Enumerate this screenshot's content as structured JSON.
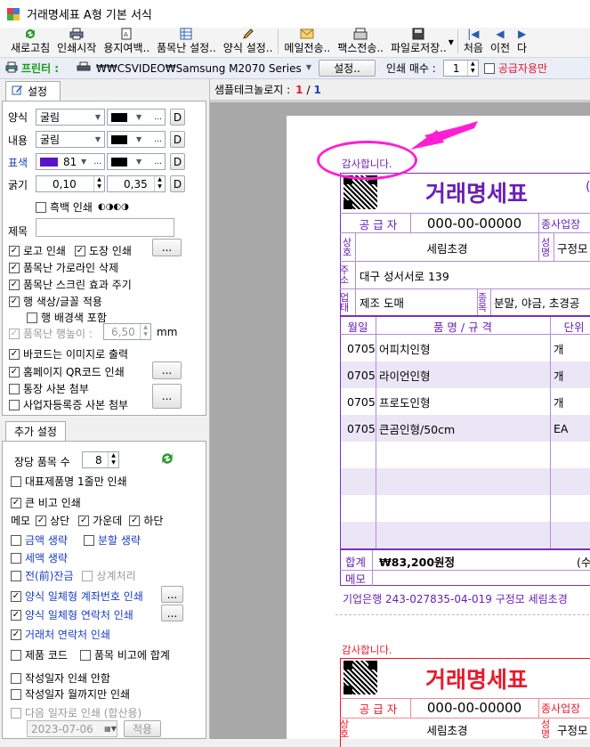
{
  "window": {
    "title": "거래명세표 A형 기본 서식"
  },
  "toolbar": {
    "items": [
      "새로고침",
      "인쇄시작",
      "용지여백..",
      "품목난 설정..",
      "양식 설정..",
      "메일전송..",
      "팩스전송..",
      "파일로저장..",
      "처음",
      "이전",
      "다"
    ]
  },
  "printer": {
    "label": "프린터 :",
    "name": "₩₩CSVIDEO₩Samsung M2070 Series",
    "settings_btn": "설정..",
    "copies_label": "인쇄 매수 :",
    "copies": "1",
    "supplier_only": "공급자용만"
  },
  "sample": {
    "label": "샘플테크놀로지 :",
    "page": "1",
    "sep": "/",
    "total": "1"
  },
  "settings": {
    "tab": "설정",
    "style_label": "양식",
    "style_font": "굴림",
    "content_label": "내용",
    "content_font": "굴림",
    "table_color_label": "표색",
    "table_color_value": "81",
    "weight_label": "굵기",
    "weight1": "0,10",
    "weight2": "0,35",
    "d": "D",
    "dots": "...",
    "bw_print": "흑백 인쇄",
    "bw_symbols": "◐◑◐◑",
    "title_label": "제목",
    "logo_print": "로고 인쇄",
    "stamp_print": "도장 인쇄",
    "remove_hlines": "품목난 가로라인 삭제",
    "screen_effect": "품목난 스크린 효과 주기",
    "row_color_font": "행 색상/글꼴 적용",
    "row_bg_include": "행 배경색 포함",
    "row_height_label": "품목난 행높이 :",
    "row_height": "6,50",
    "mm": "mm",
    "barcode_image": "바코드는 이미지로 출력",
    "homepage_qr": "홈페이지 QR코드 인쇄",
    "bankbook_copy": "통장 사본 첨부",
    "bizreg_copy": "사업자등록증 사본 첨부"
  },
  "extra": {
    "tab": "추가 설정",
    "items_per_page_label": "장당 품목 수",
    "items_per_page": "8",
    "rep_item_one_line": "대표제품명 1줄만 인쇄",
    "big_note": "큰 비고 인쇄",
    "memo_label": "메모",
    "memo_top": "상단",
    "memo_middle": "가운데",
    "memo_bottom": "하단",
    "amount_omit": "금액 생략",
    "split_omit": "분할 생략",
    "tax_omit": "세액 생략",
    "prev_balance": "전(前)잔금",
    "offset_process": "상계처리",
    "account_print": "양식 일체형 계좌번호 인쇄",
    "contact_print": "양식 일체형 연락처 인쇄",
    "client_contact": "거래처 연락처 인쇄",
    "product_code": "제품 코드",
    "sum_in_note": "품목 비고에 합계",
    "no_date": "작성일자 인쇄 안함",
    "date_to_month": "작성일자 월까지만 인쇄",
    "next_date": "다음 일자로 인쇄 (합산용)",
    "date": "2023-07-06",
    "apply": "적용"
  },
  "invoice": {
    "thanks": "감사합니다.",
    "title": "거래명세표",
    "supplier_label": "공 급 자",
    "supplier_no": "000-00-00000",
    "biz_place_label": "종사업장",
    "company_label": "상호",
    "company": "세림초경",
    "rep_label": "성명",
    "rep_name": "구정모",
    "address_label": "주소",
    "address": "대구 성서서로 139",
    "biz_type_label": "업태",
    "biz_type": "제조 도매",
    "biz_item_label": "종목",
    "biz_item": "분말, 야금, 초경공",
    "col_month_day": "월일",
    "col_item": "품 명 / 규 격",
    "col_unit": "단위",
    "rows": [
      {
        "date": "0705",
        "name": "어피치인형",
        "unit": "개"
      },
      {
        "date": "0705",
        "name": "라이언인형",
        "unit": "개"
      },
      {
        "date": "0705",
        "name": "프로도인형",
        "unit": "개"
      },
      {
        "date": "0705",
        "name": "큰곰인형/50cm",
        "unit": "EA"
      }
    ],
    "total_label": "합계",
    "total": "₩83,200원정",
    "total_right": "(수",
    "memo_label": "메모",
    "account": "기업은행 243-027835-04-019 구정모 세림초경"
  },
  "colors": {
    "accent": "#7b2fbe",
    "title": "#6a1fb5",
    "red": "#e8192c",
    "annotation": "#ff1ed2",
    "table_line": "#b58bd8"
  }
}
